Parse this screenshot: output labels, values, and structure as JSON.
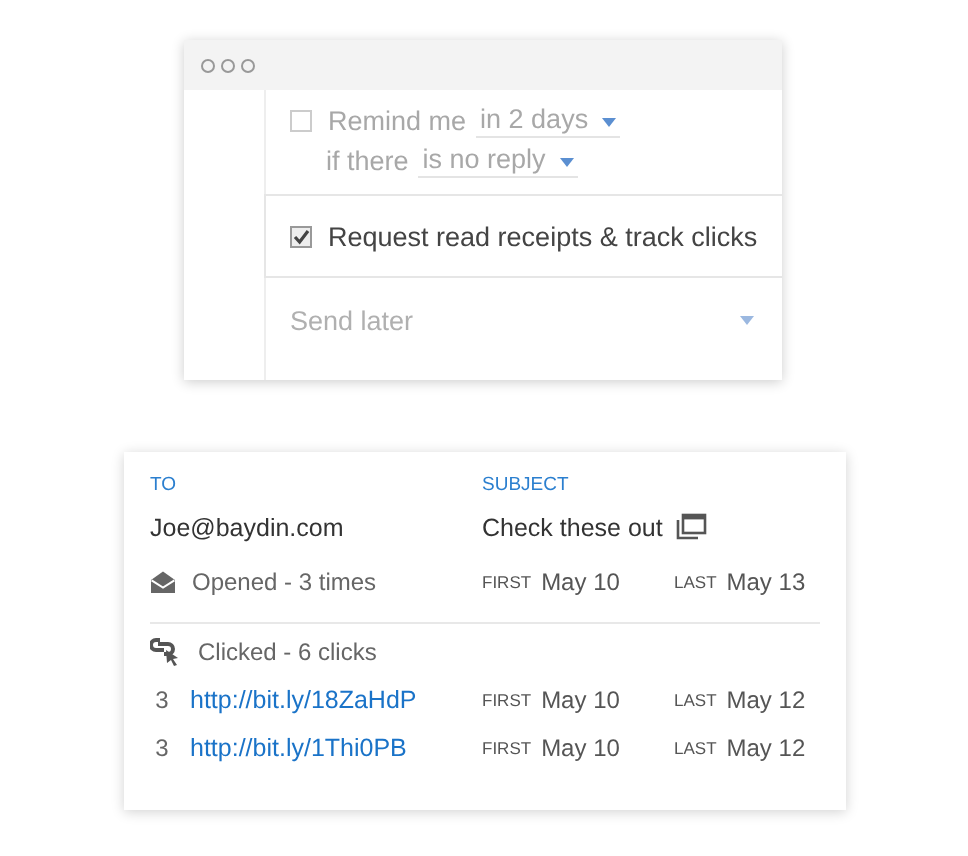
{
  "compose_options": {
    "reminder": {
      "checked": false,
      "label": "Remind me",
      "delay": "in 2 days",
      "condition_prefix": "if there",
      "condition": "is no reply"
    },
    "receipts": {
      "checked": true,
      "label": "Request read receipts & track clicks"
    },
    "send_later": {
      "label": "Send later"
    }
  },
  "tracking_card": {
    "to_heading": "TO",
    "subject_heading": "SUBJECT",
    "recipient": "Joe@baydin.com",
    "subject": "Check these out",
    "opened": {
      "label": "Opened - 3 times",
      "first_label": "FIRST",
      "first": "May 10",
      "last_label": "LAST",
      "last": "May 13"
    },
    "clicked": {
      "label": "Clicked - 6 clicks"
    },
    "links": [
      {
        "count": "3",
        "url": "http://bit.ly/18ZaHdP",
        "first_label": "FIRST",
        "first": "May 10",
        "last_label": "LAST",
        "last": "May 12"
      },
      {
        "count": "3",
        "url": "http://bit.ly/1Thi0PB",
        "first_label": "FIRST",
        "first": "May 10",
        "last_label": "LAST",
        "last": "May 12"
      }
    ]
  }
}
